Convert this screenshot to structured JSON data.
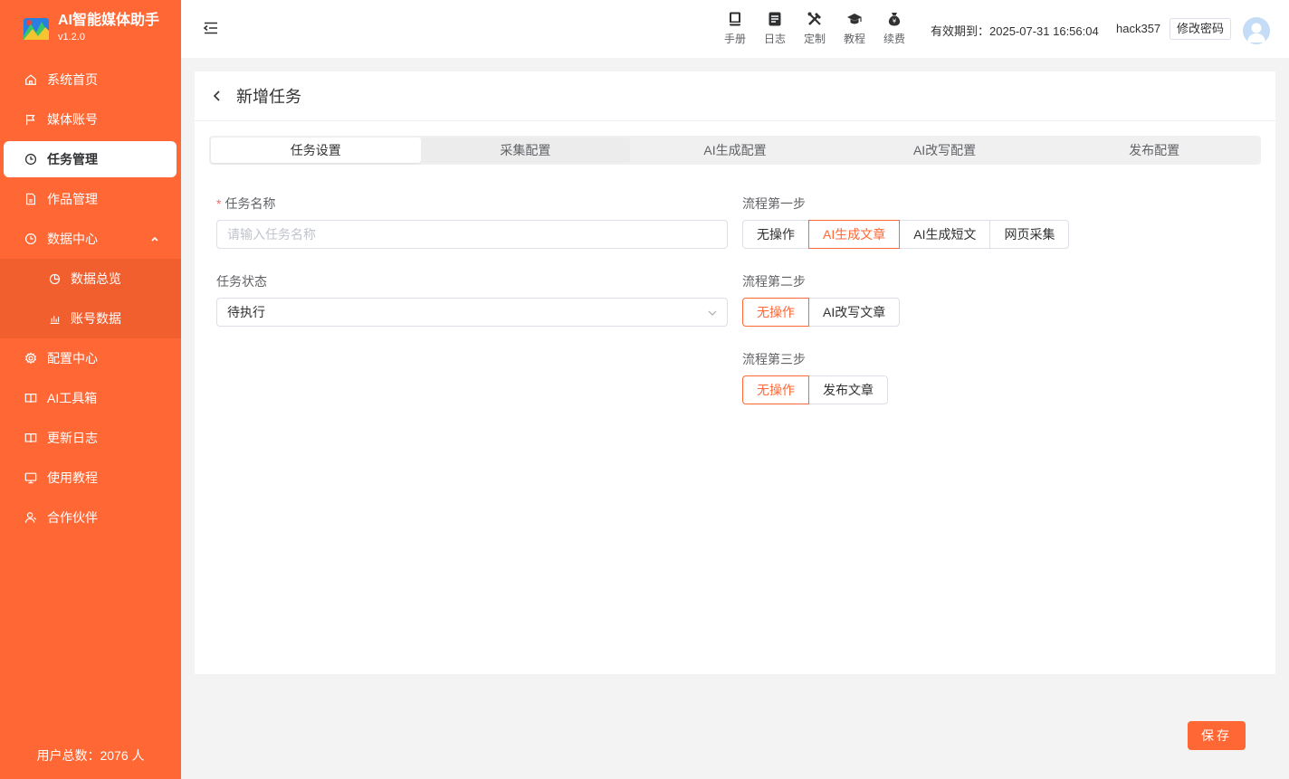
{
  "app": {
    "title": "AI智能媒体助手",
    "version": "v1.2.0",
    "accent_color": "#ff6734"
  },
  "sidebar": {
    "items": [
      {
        "label": "系统首页",
        "icon": "home-icon"
      },
      {
        "label": "媒体账号",
        "icon": "flag-icon"
      },
      {
        "label": "任务管理",
        "icon": "clock-icon",
        "active": true
      },
      {
        "label": "作品管理",
        "icon": "document-icon"
      },
      {
        "label": "数据中心",
        "icon": "clock-icon",
        "expanded": true
      }
    ],
    "subitems": [
      {
        "label": "数据总览",
        "icon": "pie-chart-icon"
      },
      {
        "label": "账号数据",
        "icon": "bar-chart-icon"
      }
    ],
    "items_after": [
      {
        "label": "配置中心",
        "icon": "gear-icon"
      },
      {
        "label": "AI工具箱",
        "icon": "book-icon"
      },
      {
        "label": "更新日志",
        "icon": "book-icon"
      },
      {
        "label": "使用教程",
        "icon": "monitor-icon"
      },
      {
        "label": "合作伙伴",
        "icon": "user-icon"
      }
    ],
    "user_count": "用户总数：2076 人"
  },
  "header": {
    "tools": [
      {
        "label": "手册",
        "icon": "manual-icon"
      },
      {
        "label": "日志",
        "icon": "log-icon"
      },
      {
        "label": "定制",
        "icon": "tools-icon"
      },
      {
        "label": "教程",
        "icon": "graduation-cap-icon"
      },
      {
        "label": "续费",
        "icon": "money-bag-icon"
      }
    ],
    "expiry": "有效期到：2025-07-31 16:56:04",
    "username": "hack357",
    "change_password": "修改密码"
  },
  "page": {
    "title": "新增任务",
    "tabs": [
      "任务设置",
      "采集配置",
      "AI生成配置",
      "AI改写配置",
      "发布配置"
    ],
    "active_tab": 0
  },
  "form": {
    "task_name_label": "任务名称",
    "task_name_placeholder": "请输入任务名称",
    "task_status_label": "任务状态",
    "task_status_value": "待执行",
    "step1_label": "流程第一步",
    "step1_options": [
      "无操作",
      "AI生成文章",
      "AI生成短文",
      "网页采集"
    ],
    "step1_selected": 1,
    "step2_label": "流程第二步",
    "step2_options": [
      "无操作",
      "AI改写文章"
    ],
    "step2_selected": 0,
    "step3_label": "流程第三步",
    "step3_options": [
      "无操作",
      "发布文章"
    ],
    "step3_selected": 0
  },
  "save_label": "保存"
}
